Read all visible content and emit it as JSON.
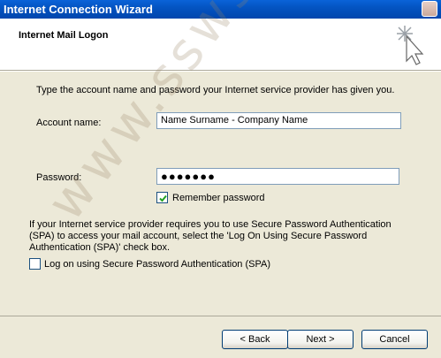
{
  "window": {
    "title": "Internet Connection Wizard",
    "header_title": "Internet Mail Logon"
  },
  "form": {
    "intro": "Type the account name and password your Internet service provider has given you.",
    "account_label": "Account name:",
    "account_value": "Name Surname - Company Name",
    "password_label": "Password:",
    "password_value": "●●●●●●●",
    "remember_label": "Remember password",
    "remember_checked": true,
    "spa_note": "If your Internet service provider requires you to use Secure Password Authentication (SPA) to access your mail account, select the 'Log On Using Secure Password Authentication (SPA)' check box.",
    "spa_label": "Log on using Secure Password Authentication (SPA)",
    "spa_checked": false
  },
  "buttons": {
    "back": "< Back",
    "next": "Next >",
    "cancel": "Cancel"
  },
  "watermark": "www.sswss.co.za",
  "colors": {
    "titlebar": "#0454C2",
    "dialog_bg": "#ECE9D8",
    "input_border": "#7F9DB9",
    "check_color": "#21A121"
  }
}
